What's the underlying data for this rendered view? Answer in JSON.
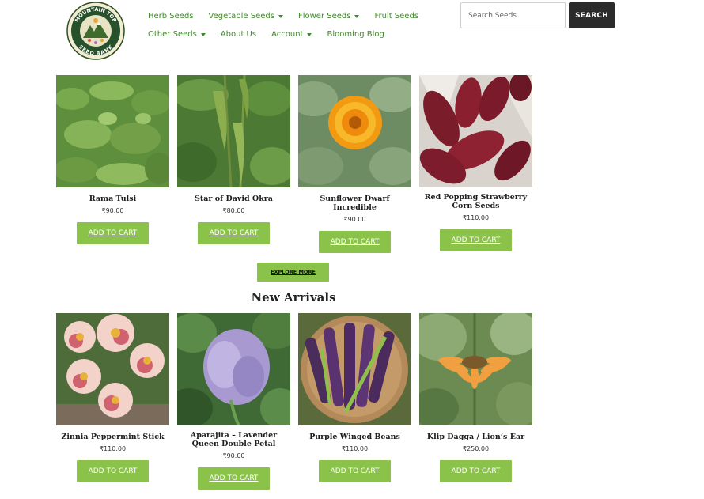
{
  "logo": {
    "top_text": "MOUNTAIN TOP",
    "bottom_text": "SEED BANK"
  },
  "nav": {
    "row1": [
      {
        "label": "Herb Seeds",
        "dropdown": false
      },
      {
        "label": "Vegetable Seeds",
        "dropdown": true
      },
      {
        "label": "Flower Seeds",
        "dropdown": true
      },
      {
        "label": "Fruit Seeds",
        "dropdown": false
      }
    ],
    "row2": [
      {
        "label": "Other Seeds",
        "dropdown": true
      },
      {
        "label": "About Us",
        "dropdown": false
      },
      {
        "label": "Account",
        "dropdown": true
      },
      {
        "label": "Blooming Blog",
        "dropdown": false
      }
    ]
  },
  "search": {
    "placeholder": "Search Seeds",
    "button_label": "SEARCH"
  },
  "featured": [
    {
      "name": "Rama Tulsi",
      "price": "₹90.00",
      "cart_label": "ADD TO CART"
    },
    {
      "name": "Star of David Okra",
      "price": "₹80.00",
      "cart_label": "ADD TO CART"
    },
    {
      "name": "Sunflower Dwarf Incredible",
      "price": "₹90.00",
      "cart_label": "ADD TO CART"
    },
    {
      "name": "Red Popping Strawberry Corn Seeds",
      "price": "₹110.00",
      "cart_label": "ADD TO CART"
    }
  ],
  "explore_label": "EXPLORE MORE",
  "new_arrivals": {
    "title": "New Arrivals",
    "items": [
      {
        "name": "Zinnia Peppermint Stick",
        "price": "₹110.00",
        "cart_label": "ADD TO CART"
      },
      {
        "name": "Aparajita – Lavender Queen Double Petal",
        "price": "₹90.00",
        "cart_label": "ADD TO CART"
      },
      {
        "name": "Purple Winged Beans",
        "price": "₹110.00",
        "cart_label": "ADD TO CART"
      },
      {
        "name": "Klip Dagga / Lion’s Ear",
        "price": "₹250.00",
        "cart_label": "ADD TO CART"
      }
    ]
  },
  "colors": {
    "accent_green": "#8bc34a",
    "nav_green": "#3f8a2a",
    "search_button": "#2b2b2b"
  }
}
